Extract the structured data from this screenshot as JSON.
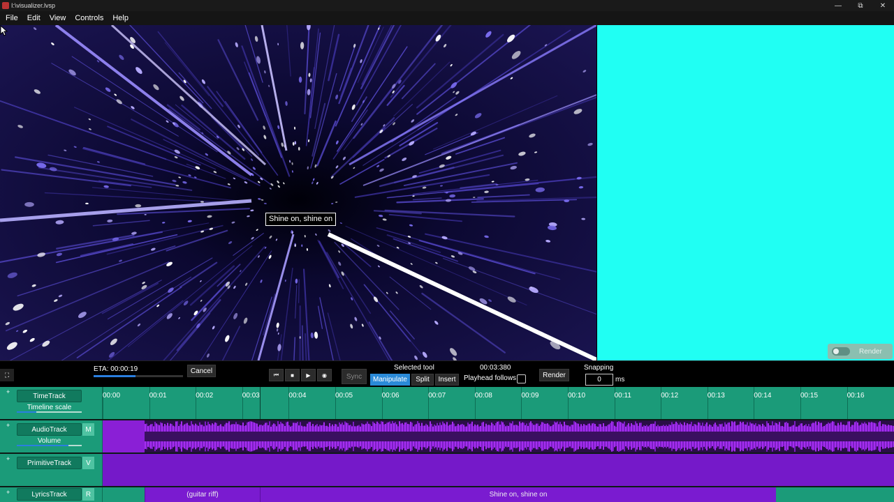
{
  "window": {
    "title": "I:\\visualizer.lvsp",
    "controls": {
      "minimize": "—",
      "restore": "⧉",
      "close": "✕"
    }
  },
  "menu": [
    "File",
    "Edit",
    "View",
    "Controls",
    "Help"
  ],
  "preview": {
    "lyric_text": "Shine on, shine on",
    "render_toggle_label": "Render"
  },
  "controls": {
    "eta": "ETA: 00:00:19",
    "eta_progress": 0.47,
    "cancel": "Cancel",
    "sync": "Sync",
    "selected_tool_label": "Selected tool",
    "tools": [
      "Manipulate",
      "Split",
      "Insert"
    ],
    "active_tool": "Manipulate",
    "time": "00:03:380",
    "playhead_follows": "Playhead follows",
    "render": "Render",
    "snapping_label": "Snapping",
    "snapping_value": "0",
    "snapping_unit": "ms"
  },
  "tracks": {
    "time": {
      "name": "TimeTrack",
      "sub_label": "Timeline scale",
      "ticks": [
        "00:00",
        "00:01",
        "00:02",
        "00:03",
        "00:04",
        "00:05",
        "00:06",
        "00:07",
        "00:08",
        "00:09",
        "00:10",
        "00:11",
        "00:12",
        "00:13",
        "00:14",
        "00:15",
        "00:16"
      ]
    },
    "audio": {
      "name": "AudioTrack",
      "flag": "M",
      "sub_label": "Volume",
      "volume": 0.8
    },
    "primitive": {
      "name": "PrimitiveTrack",
      "flag": "V"
    },
    "lyrics": {
      "name": "LyricsTrack",
      "flag": "R",
      "segments": [
        "(guitar riff)",
        "Shine on, shine on"
      ]
    }
  },
  "colors": {
    "track_green": "#1b9b79",
    "track_purple": "#7519c9",
    "preview_cyan": "#20fff3",
    "accent_blue": "#2a8ad8"
  }
}
